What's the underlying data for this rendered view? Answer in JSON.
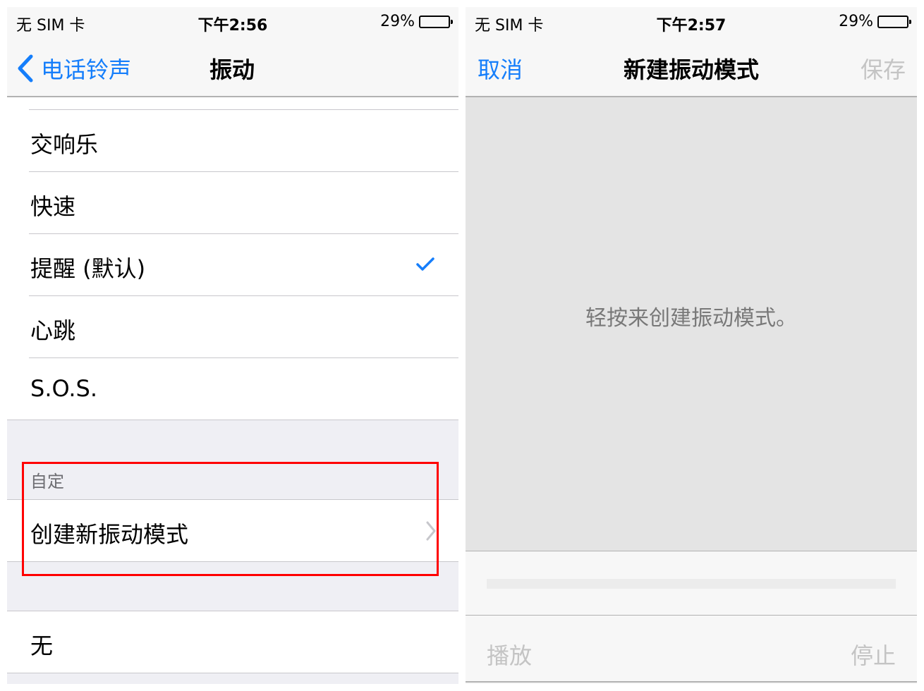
{
  "left_screen": {
    "status_bar": {
      "carrier": "无 SIM 卡",
      "time": "下午2:56",
      "battery_percent_label": "29%",
      "battery_level": 0.29
    },
    "nav": {
      "back_label": "电话铃声",
      "title": "振动"
    },
    "standard_items": [
      {
        "label": "交响乐",
        "selected": false
      },
      {
        "label": "快速",
        "selected": false
      },
      {
        "label": "提醒 (默认)",
        "selected": true
      },
      {
        "label": "心跳",
        "selected": false
      },
      {
        "label": "S.O.S.",
        "selected": false
      }
    ],
    "custom_section": {
      "header": "自定",
      "create_label": "创建新振动模式"
    },
    "none_item": {
      "label": "无"
    },
    "accent_color": "#157efb",
    "highlight_color": "#ff0000"
  },
  "right_screen": {
    "status_bar": {
      "carrier": "无 SIM 卡",
      "time": "下午2:57",
      "battery_percent_label": "29%",
      "battery_level": 0.29
    },
    "nav": {
      "cancel_label": "取消",
      "title": "新建振动模式",
      "save_label": "保存"
    },
    "hint": "轻按来创建振动模式。",
    "toolbar": {
      "play_label": "播放",
      "stop_label": "停止"
    },
    "progress": 0
  }
}
